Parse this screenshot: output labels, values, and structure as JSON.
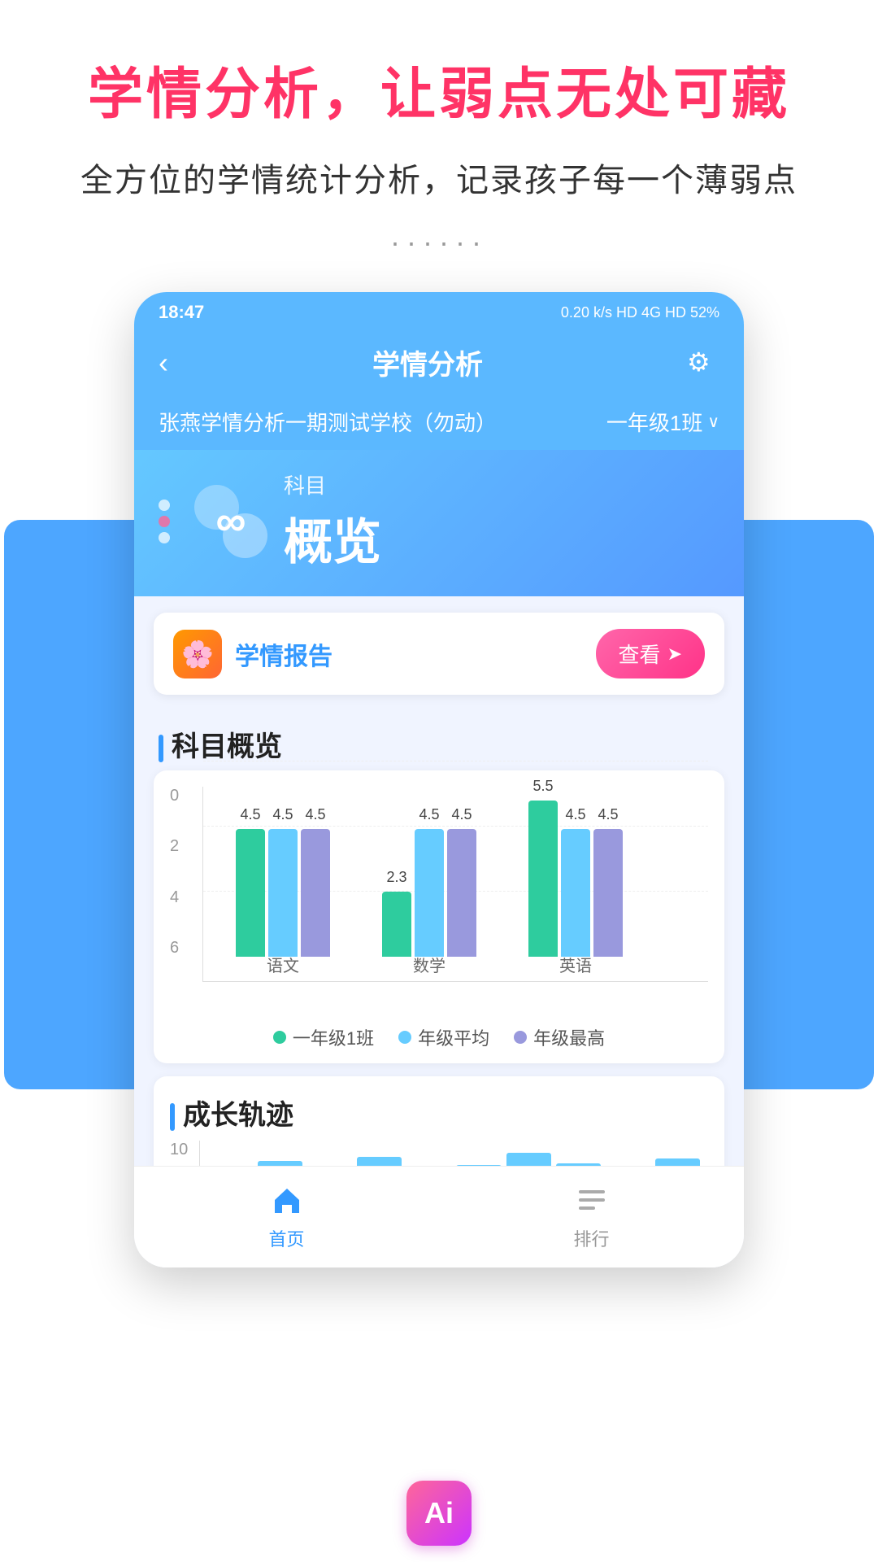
{
  "page": {
    "main_title": "学情分析，让弱点无处可藏",
    "sub_title": "全方位的学情统计分析，记录孩子每一个薄弱点",
    "dots": "······"
  },
  "status_bar": {
    "time": "18:47",
    "right_icons": "0.20 k/s  HD 4G  HD 52%"
  },
  "header": {
    "back": "‹",
    "title": "学情分析",
    "settings": "⚙"
  },
  "school_bar": {
    "school_name": "张燕学情分析一期测试学校（勿动）",
    "class": "一年级1班",
    "chevron": "∨"
  },
  "tab": {
    "label_small": "科目",
    "label_big": "概览"
  },
  "report_card": {
    "title": "学情报告",
    "view_btn": "查看",
    "icon": "🌸"
  },
  "subject_overview": {
    "section_title": "科目概览",
    "chart": {
      "y_labels": [
        "0",
        "2",
        "4",
        "6"
      ],
      "groups": [
        {
          "name": "语文",
          "bars": [
            {
              "value": 4.5,
              "label": "4.5",
              "type": "green"
            },
            {
              "value": 4.5,
              "label": "4.5",
              "type": "light-blue"
            },
            {
              "value": 4.5,
              "label": "4.5",
              "type": "purple"
            }
          ]
        },
        {
          "name": "数学",
          "bars": [
            {
              "value": 2.3,
              "label": "2.3",
              "type": "green"
            },
            {
              "value": 4.5,
              "label": "4.5",
              "type": "light-blue"
            },
            {
              "value": 4.5,
              "label": "4.5",
              "type": "purple"
            }
          ]
        },
        {
          "name": "英语",
          "bars": [
            {
              "value": 5.5,
              "label": "5.5",
              "type": "green"
            },
            {
              "value": 4.5,
              "label": "4.5",
              "type": "light-blue"
            },
            {
              "value": 4.5,
              "label": "4.5",
              "type": "purple"
            }
          ]
        }
      ],
      "legend": [
        {
          "label": "一年级1班",
          "type": "green"
        },
        {
          "label": "年级平均",
          "type": "light-blue"
        },
        {
          "label": "年级最高",
          "type": "purple"
        }
      ]
    }
  },
  "growth_section": {
    "section_title": "成长轨迹",
    "y_label": "10"
  },
  "bottom_nav": {
    "items": [
      {
        "label": "首页",
        "active": true,
        "icon": "🏠"
      },
      {
        "label": "排行",
        "active": false,
        "icon": "📋"
      }
    ]
  },
  "ai_badge": {
    "label": "Ai"
  }
}
